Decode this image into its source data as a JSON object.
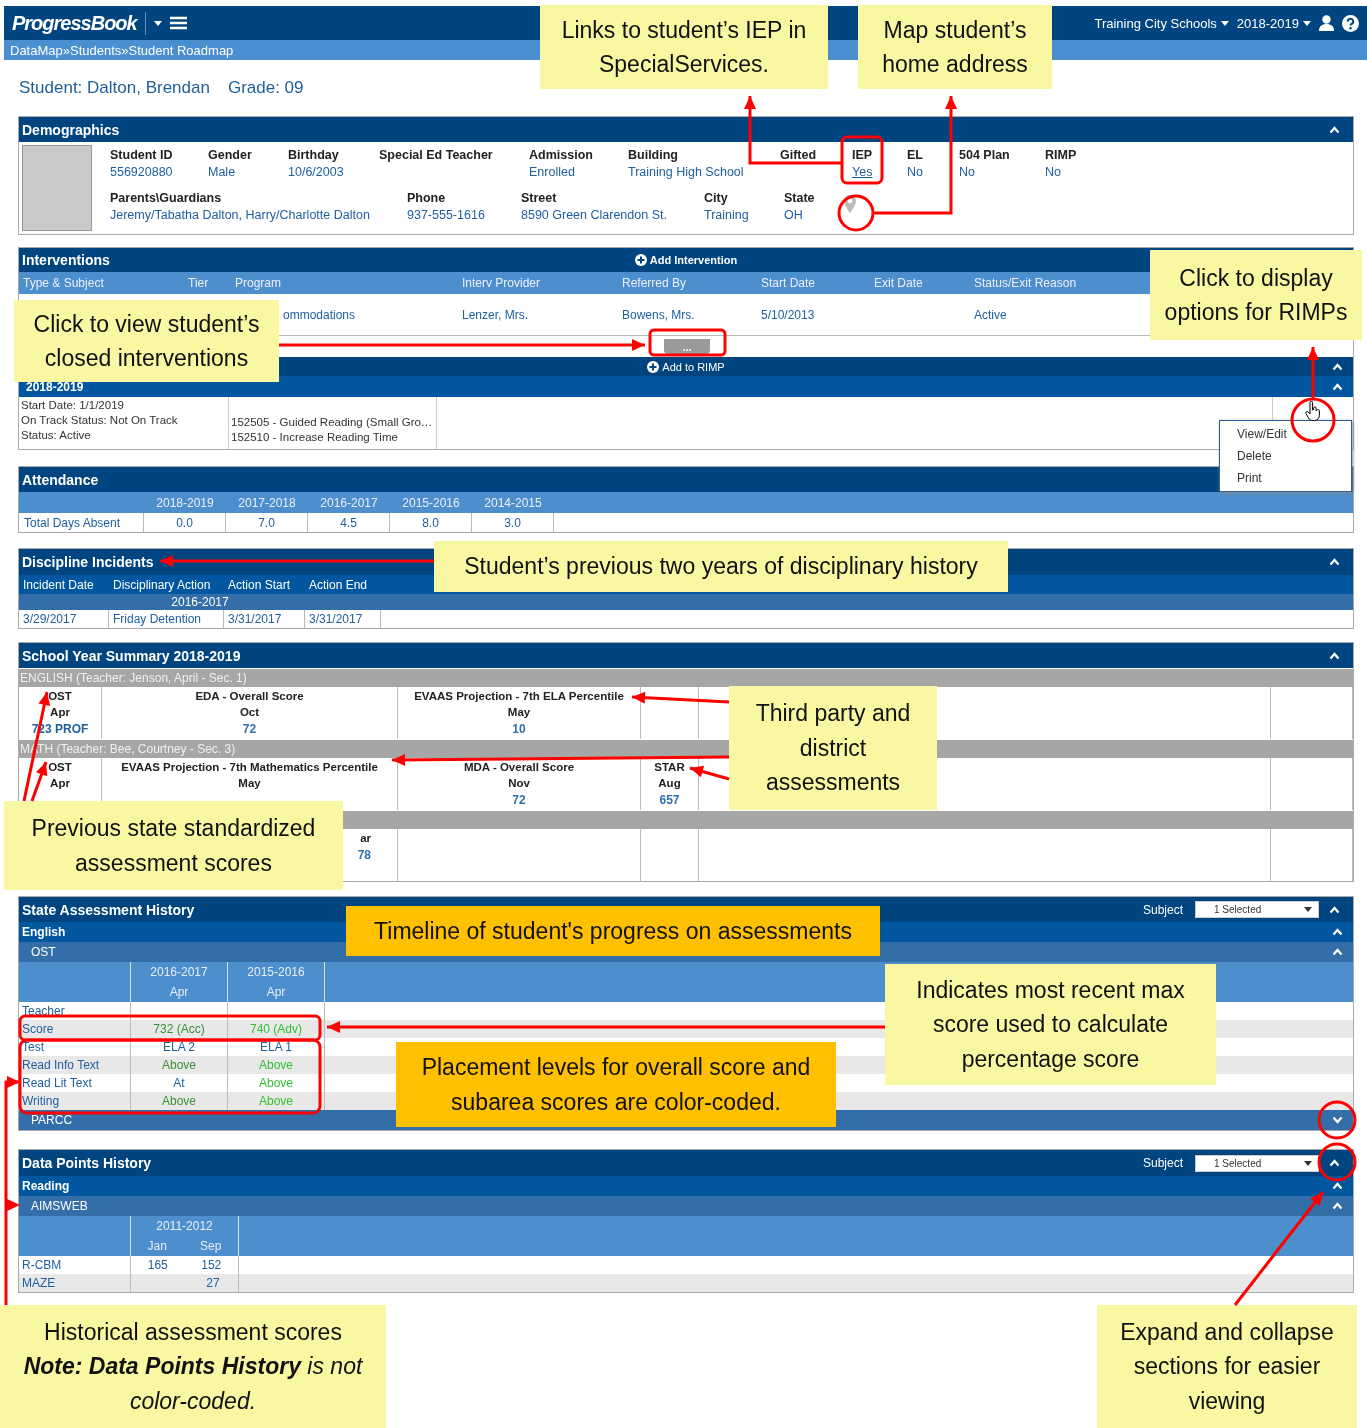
{
  "header": {
    "logo": "ProgressBook",
    "district": "Training City Schools",
    "year": "2018-2019"
  },
  "breadcrumb": {
    "separator": "»",
    "items": [
      "DataMap",
      "Students",
      "Student Roadmap"
    ]
  },
  "student": {
    "name": "Student: Dalton, Brendan",
    "grade": "Grade: 09"
  },
  "demographics": {
    "title": "Demographics",
    "expanded": true,
    "row_1": [
      {
        "label": "Student ID",
        "value": "556920880"
      },
      {
        "label": "Gender",
        "value": "Male"
      },
      {
        "label": "Birthday",
        "value": "10/6/2003"
      },
      {
        "label": "Special Ed Teacher"
      },
      {
        "label": "Admission",
        "value": "Enrolled"
      },
      {
        "label": "Building",
        "value": "Training High School"
      },
      {
        "label": "Gifted"
      },
      {
        "label": "IEP",
        "value": "Yes",
        "kind": "link"
      },
      {
        "label": "EL",
        "value": "No"
      },
      {
        "label": "504 Plan",
        "value": "No"
      },
      {
        "label": "RIMP",
        "value": "No"
      }
    ],
    "row_2": [
      {
        "label": "Parents\\Guardians",
        "value": "Jeremy/Tabatha Dalton, Harry/Charlotte Dalton"
      },
      {
        "label": "Phone",
        "value": "937-555-1616"
      },
      {
        "label": "Street",
        "value": "8590 Green Clarendon St."
      },
      {
        "label": "City",
        "value": "Training"
      },
      {
        "label": "State",
        "value": "OH"
      }
    ]
  },
  "interventions": {
    "title": "Interventions",
    "add_button": "Add Intervention",
    "columns": [
      "Type & Subject",
      "Tier",
      "Program",
      "Interv Provider",
      "Referred By",
      "Start Date",
      "Exit Date",
      "Status/Exit Reason"
    ],
    "row": {
      "program": "ommodations",
      "provider": "Lenzer, Mrs.",
      "referred_by": "Bowens, Mrs.",
      "start_date": "5/10/2013",
      "status": "Active"
    },
    "more_button": "...",
    "rimp": {
      "add_button": "Add to RIMP",
      "expanded": true,
      "year": "2018-2019",
      "year_expanded": true,
      "details": [
        "Start Date: 1/1/2019",
        "On Track Status: Not On Track",
        "Status: Active"
      ],
      "items": [
        "152505 - Guided Reading (Small Gro…",
        "152510 - Increase Reading Time"
      ],
      "menu": [
        "View/Edit",
        "Delete",
        "Print"
      ]
    }
  },
  "attendance": {
    "title": "Attendance",
    "years": [
      "2018-2019",
      "2017-2018",
      "2016-2017",
      "2015-2016",
      "2014-2015"
    ],
    "row": {
      "label": "Total Days Absent",
      "values": [
        "0.0",
        "7.0",
        "4.5",
        "8.0",
        "3.0"
      ]
    }
  },
  "discipline": {
    "title": "Discipline Incidents",
    "expanded": true,
    "columns": [
      "Incident Date",
      "Disciplinary Action",
      "Action Start",
      "Action End"
    ],
    "year": "2016-2017",
    "rows": [
      [
        "3/29/2017",
        "Friday Detention",
        "3/31/2017",
        "3/31/2017"
      ]
    ]
  },
  "school_year_summary": {
    "title": "School Year Summary 2018-2019",
    "expanded": true,
    "courses": [
      {
        "name": "ENGLISH (Teacher: Jenson, April - Sec. 1)",
        "assessments": [
          {
            "name": "OST",
            "month": "Apr",
            "score": "723 PROF",
            "color": "#1f5f99"
          },
          {
            "name": "EDA - Overall Score",
            "month": "Oct",
            "score": "72",
            "color": "#2f6fb0"
          },
          {
            "name": "EVAAS Projection - 7th ELA Percentile",
            "month": "May",
            "score": "10",
            "color": "#2f6fb0"
          }
        ]
      },
      {
        "name": "MATH (Teacher: Bee, Courtney - Sec. 3)",
        "assessments": [
          {
            "name": "OST",
            "month": "Apr"
          },
          {
            "name": "EVAAS Projection - 7th Mathematics Percentile",
            "month": "May"
          },
          {
            "name": "MDA - Overall Score",
            "month": "Nov",
            "score": "72",
            "color": "#2f6fb0"
          },
          {
            "name": "STAR",
            "month": "Aug",
            "score": "657",
            "color": "#2f6fb0"
          }
        ]
      },
      {
        "assessments": [
          {
            "kind": "partial",
            "name": "ar",
            "score": "78",
            "color": "#2f6fb0"
          }
        ]
      }
    ]
  },
  "state_assessment_history": {
    "title": "State Assessment History",
    "expanded": true,
    "subject_label": "Subject",
    "subject_value": "1 Selected",
    "subject": "English",
    "subject_expanded": true,
    "tests": [
      {
        "name": "OST",
        "expanded": true,
        "columns": [
          {
            "year": "2016-2017",
            "month": "Apr"
          },
          {
            "year": "2015-2016",
            "month": "Apr"
          }
        ],
        "rows": [
          {
            "label": "Teacher",
            "cells": []
          },
          {
            "label": "Score",
            "cells": [
              {
                "text": "732 (Acc)",
                "color": "#3a8f3a"
              },
              {
                "text": "740 (Adv)",
                "color": "#33c033"
              }
            ]
          },
          {
            "label": "Test",
            "cells": [
              {
                "text": "ELA 2",
                "color": "#1f5f99"
              },
              {
                "text": "ELA 1",
                "color": "#1f5f99"
              }
            ]
          },
          {
            "label": "Read Info Text",
            "cells": [
              {
                "text": "Above",
                "color": "#3a8f3a"
              },
              {
                "text": "Above",
                "color": "#33c033"
              }
            ]
          },
          {
            "label": "Read Lit Text",
            "cells": [
              {
                "text": "At",
                "color": "#1f5f99"
              },
              {
                "text": "Above",
                "color": "#33c033"
              }
            ]
          },
          {
            "label": "Writing",
            "cells": [
              {
                "text": "Above",
                "color": "#3a8f3a"
              },
              {
                "text": "Above",
                "color": "#33c033"
              }
            ]
          }
        ]
      },
      {
        "name": "PARCC",
        "expanded": false
      }
    ]
  },
  "data_points_history": {
    "title": "Data Points History",
    "expanded": true,
    "subject_label": "Subject",
    "subject_value": "1 Selected",
    "subject": "Reading",
    "subject_expanded": true,
    "test": "AIMSWEB",
    "test_expanded": true,
    "year": "2011-2012",
    "months": [
      "Jan",
      "Sep"
    ],
    "rows": [
      {
        "label": "R-CBM",
        "jan": "165",
        "sep": "152"
      },
      {
        "label": "MAZE",
        "sep": "27"
      }
    ]
  },
  "callouts": [
    {
      "kind": "note",
      "text": "Links to student’s IEP in SpecialServices."
    },
    {
      "kind": "note",
      "text": "Map student’s home address"
    },
    {
      "kind": "note",
      "text": "Click to display options for RIMPs"
    },
    {
      "kind": "note",
      "text": "Click to view student’s closed interventions"
    },
    {
      "kind": "note",
      "text": "Student’s previous two years of disciplinary history"
    },
    {
      "kind": "note",
      "text": "Third party and district assessments"
    },
    {
      "kind": "note",
      "text": "Previous state standardized assessment scores"
    },
    {
      "kind": "emphasis",
      "text": "Timeline of student's progress on assessments"
    },
    {
      "kind": "note",
      "text": "Indicates most recent max score used to calculate percentage score"
    },
    {
      "kind": "emphasis",
      "text": "Placement levels for overall score and subarea scores are color-coded."
    },
    {
      "kind": "note",
      "text": "Historical assessment scores",
      "note": "**Note: Data Points History** is not color-coded."
    },
    {
      "kind": "note",
      "text": "Expand and collapse sections for easier viewing"
    }
  ]
}
